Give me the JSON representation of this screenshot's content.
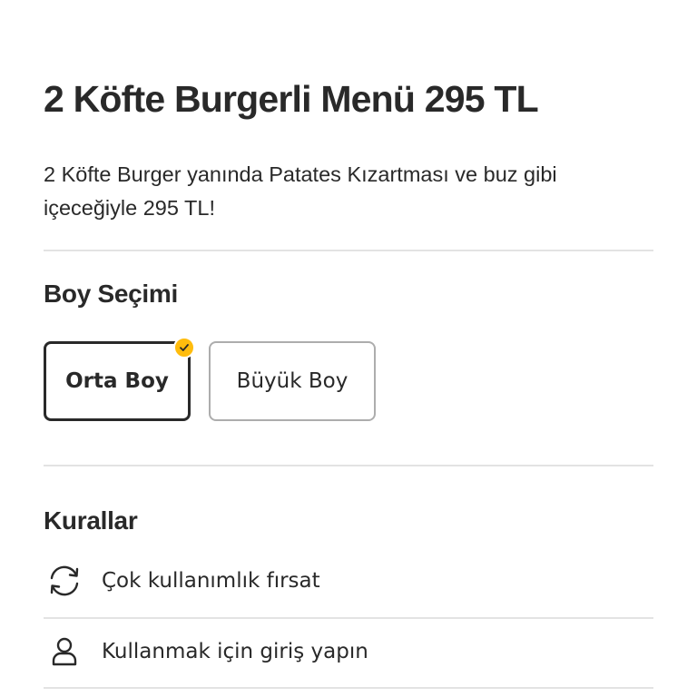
{
  "offer": {
    "title": "2 Köfte Burgerli Menü 295 TL",
    "description": "2 Köfte Burger yanında Patates Kızartması ve buz gibi içeceğiyle 295 TL!"
  },
  "size_selection": {
    "heading": "Boy Seçimi",
    "options": [
      {
        "label": "Orta Boy",
        "selected": true
      },
      {
        "label": "Büyük Boy",
        "selected": false
      }
    ]
  },
  "rules": {
    "heading": "Kurallar",
    "items": [
      {
        "icon": "refresh-icon",
        "label": "Çok kullanımlık fırsat"
      },
      {
        "icon": "user-icon",
        "label": "Kullanmak için giriş yapın"
      }
    ]
  },
  "colors": {
    "text": "#292929",
    "accent": "#ffbc0d",
    "divider": "#e3e3e3",
    "unselected_border": "#adadad"
  }
}
